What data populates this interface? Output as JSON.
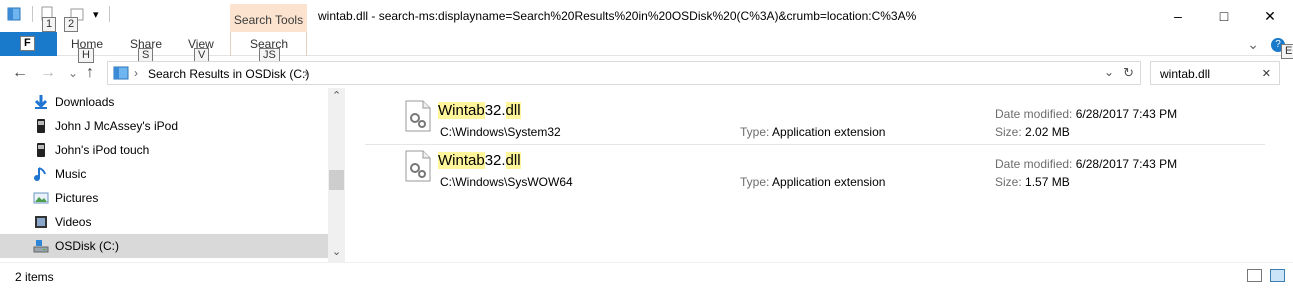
{
  "window": {
    "title": "wintab.dll - search-ms:displayname=Search%20Results%20in%20OSDisk%20(C%3A)&crumb=location:C%3A%",
    "context_tab": "Search Tools",
    "minimize": "–",
    "maximize": "□",
    "close": "✕"
  },
  "qat": {
    "keytip_1": "1",
    "keytip_2": "2",
    "dropdown": "▾"
  },
  "ribbon": {
    "file_label": "F",
    "tabs": [
      {
        "label": "Home",
        "keytip": "H"
      },
      {
        "label": "Share",
        "keytip": "S"
      },
      {
        "label": "View",
        "keytip": "V"
      },
      {
        "label": "Search",
        "keytip": "JS"
      }
    ],
    "collapse": "⌄",
    "help_keytip": "E"
  },
  "address": {
    "back": "←",
    "forward": "→",
    "recent": "⌄",
    "up": "↑",
    "crumb_sep": "›",
    "path": "Search Results in OSDisk (C:)",
    "path_arrow": "›",
    "dropdown": "⌄",
    "refresh": "↻"
  },
  "search": {
    "value": "wintab.dll",
    "clear": "✕"
  },
  "nav": {
    "items": [
      {
        "label": "Downloads",
        "icon": "download-icon"
      },
      {
        "label": "John J McAssey's iPod",
        "icon": "ipod-icon"
      },
      {
        "label": "John's iPod touch",
        "icon": "ipod-icon"
      },
      {
        "label": "Music",
        "icon": "music-icon"
      },
      {
        "label": "Pictures",
        "icon": "pictures-icon"
      },
      {
        "label": "Videos",
        "icon": "videos-icon"
      },
      {
        "label": "OSDisk (C:)",
        "icon": "drive-icon",
        "selected": true
      }
    ],
    "scroll_up": "⌃",
    "scroll_down": "⌄"
  },
  "results": [
    {
      "name_hl1": "Wintab",
      "name_mid": "32.",
      "name_hl2": "dll",
      "path": "C:\\Windows\\System32",
      "type_label": "Type:",
      "type": "Application extension",
      "date_label": "Date modified:",
      "date": "6/28/2017 7:43 PM",
      "size_label": "Size:",
      "size": "2.02 MB"
    },
    {
      "name_hl1": "Wintab",
      "name_mid": "32.",
      "name_hl2": "dll",
      "path": "C:\\Windows\\SysWOW64",
      "type_label": "Type:",
      "type": "Application extension",
      "date_label": "Date modified:",
      "date": "6/28/2017 7:43 PM",
      "size_label": "Size:",
      "size": "1.57 MB"
    }
  ],
  "status": {
    "count": "2 items"
  },
  "colors": {
    "accent": "#1979ca",
    "context_tab": "#fbe3cf",
    "highlight": "#fff59a",
    "selected": "#d9d9d9"
  }
}
